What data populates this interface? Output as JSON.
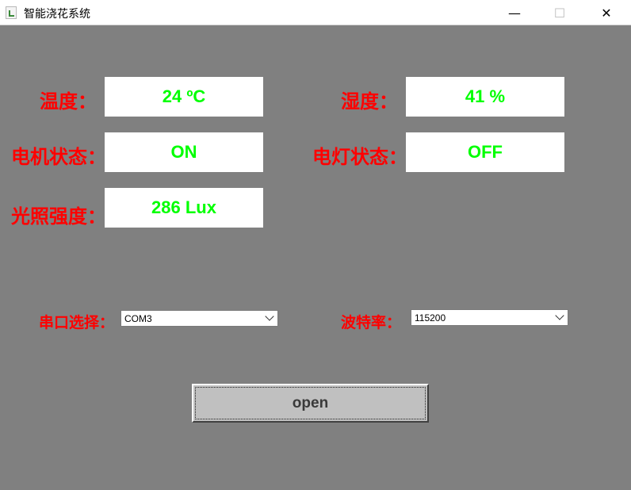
{
  "window": {
    "title": "智能浇花系统",
    "minimize_glyph": "—",
    "maximize_glyph": "☐",
    "close_glyph": "✕"
  },
  "sensors": {
    "temperature": {
      "label": "温度：",
      "value": "24 ºC"
    },
    "humidity": {
      "label": "湿度：",
      "value": "41 %"
    },
    "motor": {
      "label": "电机状态：",
      "value": "ON"
    },
    "lamp": {
      "label": "电灯状态：",
      "value": "OFF"
    },
    "light": {
      "label": "光照强度：",
      "value": "286 Lux"
    }
  },
  "serial": {
    "port_label": "串口选择：",
    "port_value": "COM3",
    "baud_label": "波特率：",
    "baud_value": "115200"
  },
  "open_button": "open",
  "colors": {
    "background": "#808080",
    "label": "#ff0000",
    "value": "#00ff00"
  }
}
